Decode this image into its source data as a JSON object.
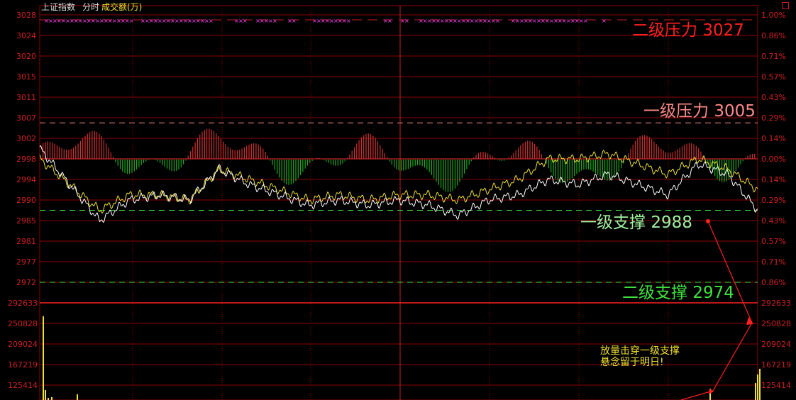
{
  "header": {
    "index_name": "上证指数",
    "period": "分时",
    "indicator": "成交额(万)"
  },
  "colors": {
    "background": "#000000",
    "grid": "#8b0000",
    "axis_text": "#d02020",
    "price_line": "#ffffff",
    "avg_line": "#f0e030",
    "up_bar": "#d03030",
    "down_bar": "#1faa1f",
    "support": "#3fe03f",
    "pressure1": "#ff8888",
    "pressure2": "#ff2020",
    "marker": "#ff40ff",
    "arrow": "#ff2020"
  },
  "annotations": {
    "pressure2": {
      "text": "二级压力",
      "value": "3027"
    },
    "pressure1": {
      "text": "一级压力",
      "value": "3005"
    },
    "support1": {
      "text": "一级支撑",
      "value": "2988"
    },
    "support2": {
      "text": "二级支撑",
      "value": "2974"
    },
    "note_line1": "放量击穿一级支撑",
    "note_line2": "悬念留于明日!"
  },
  "chart_data": {
    "type": "line",
    "title": "上证指数 分时",
    "price_axis": {
      "ticks": [
        "3028",
        "3024",
        "3020",
        "3015",
        "3011",
        "3007",
        "3002",
        "2998",
        "2994",
        "2990",
        "2985",
        "2981",
        "2977",
        "2972"
      ],
      "ylim": [
        2972,
        3028
      ],
      "pct_ticks": [
        "1.00%",
        "0.86%",
        "0.71%",
        "0.57%",
        "0.43%",
        "0.29%",
        "0.14%",
        "0.00%",
        "0.14%",
        "0.29%",
        "0.43%",
        "0.57%",
        "0.71%",
        "0.86%"
      ]
    },
    "volume_axis": {
      "ticks": [
        "292633",
        "250828",
        "209024",
        "167219",
        "125414"
      ],
      "label": "成交额(万)"
    },
    "reference_lines": [
      {
        "name": "一级压力",
        "value": 3005
      },
      {
        "name": "一级支撑",
        "value": 2988
      },
      {
        "name": "二级支撑",
        "value": 2974
      }
    ],
    "x": [
      0,
      10,
      20,
      30,
      40,
      50,
      60,
      70,
      80,
      90,
      100,
      110,
      120,
      130,
      140,
      150,
      160,
      170,
      180,
      190,
      200,
      210,
      220,
      230,
      240
    ],
    "series": [
      {
        "values": [
          3000,
          2993,
          2986,
          2990,
          2991,
          2990,
          2996,
          2993,
          2991,
          2989,
          2990,
          2989,
          2990,
          2989,
          2987,
          2990,
          2991,
          2994,
          2993,
          2995,
          2993,
          2991,
          2997,
          2995,
          2988
        ]
      },
      {
        "values": [
          2998,
          2993,
          2988,
          2991,
          2991,
          2990,
          2996,
          2994,
          2992,
          2990,
          2991,
          2990,
          2991,
          2991,
          2990,
          2992,
          2994,
          2998,
          2998,
          2999,
          2997,
          2995,
          2998,
          2996,
          2992
        ]
      }
    ]
  }
}
